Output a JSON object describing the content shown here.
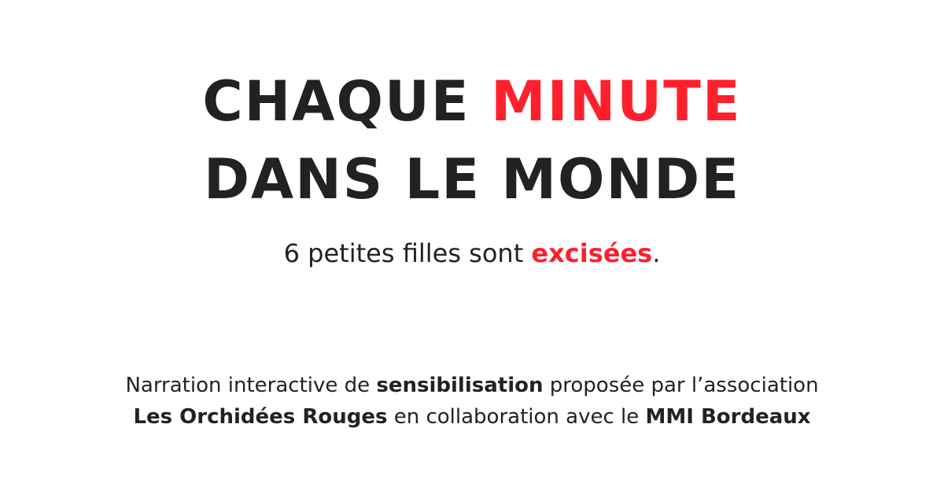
{
  "headline": {
    "line1_prefix": "CHAQUE ",
    "line1_accent": "MINUTE",
    "line2": "DANS LE MONDE"
  },
  "tagline": {
    "prefix": "6 petites filles sont ",
    "accent": "excisées",
    "suffix": "."
  },
  "credits": {
    "line1_prefix": "Narration interactive de ",
    "line1_bold": "sensibilisation",
    "line1_suffix": " proposée par l’association",
    "line2_bold1": "Les Orchidées Rouges",
    "line2_middle": " en collaboration avec le ",
    "line2_bold2": "MMI Bordeaux"
  },
  "colors": {
    "text": "#222222",
    "accent": "#ff1f2d",
    "background": "#ffffff"
  }
}
